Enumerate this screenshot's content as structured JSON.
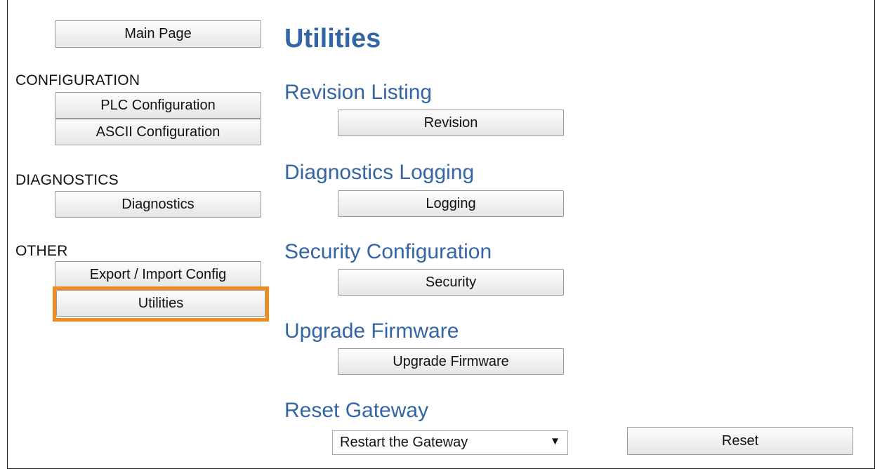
{
  "sidebar": {
    "main_page": "Main Page",
    "configuration_label": "CONFIGURATION",
    "plc_configuration": "PLC Configuration",
    "ascii_configuration": "ASCII Configuration",
    "diagnostics_label": "DIAGNOSTICS",
    "diagnostics": "Diagnostics",
    "other_label": "OTHER",
    "export_import": "Export / Import Config",
    "utilities": "Utilities",
    "active_item": "utilities"
  },
  "main": {
    "title": "Utilities",
    "revision": {
      "heading": "Revision Listing",
      "button": "Revision"
    },
    "logging": {
      "heading": "Diagnostics Logging",
      "button": "Logging"
    },
    "security": {
      "heading": "Security Configuration",
      "button": "Security"
    },
    "firmware": {
      "heading": "Upgrade Firmware",
      "button": "Upgrade Firmware"
    },
    "reset": {
      "heading": "Reset Gateway",
      "select_value": "Restart the Gateway",
      "button": "Reset"
    }
  },
  "colors": {
    "heading": "#3465a4",
    "highlight": "#f08c1e"
  },
  "icons": {
    "dropdown": "chevron-down-icon"
  }
}
